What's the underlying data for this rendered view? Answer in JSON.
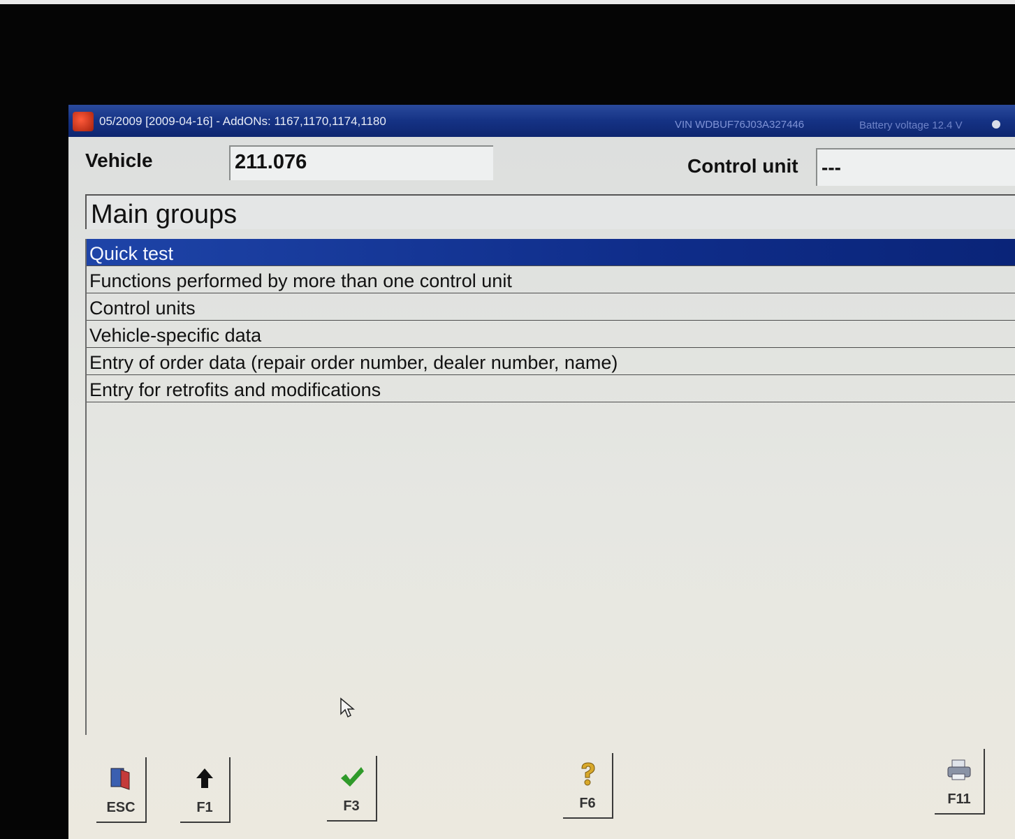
{
  "window": {
    "title": "05/2009 [2009-04-16] - AddONs: 1167,1170,1174,1180",
    "vin": "VIN  WDBUF76J03A327446",
    "battery": "Battery voltage  12.4 V"
  },
  "header": {
    "vehicle_label": "Vehicle",
    "vehicle_value": "211.076",
    "control_unit_label": "Control unit",
    "control_unit_value": "---"
  },
  "groups": {
    "title": "Main groups",
    "items": [
      {
        "label": "Quick test",
        "selected": true
      },
      {
        "label": "Functions performed by more than one control unit",
        "selected": false
      },
      {
        "label": "Control units",
        "selected": false
      },
      {
        "label": "Vehicle-specific data",
        "selected": false
      },
      {
        "label": "Entry of order data (repair order number, dealer number, name)",
        "selected": false
      },
      {
        "label": "Entry for retrofits and modifications",
        "selected": false
      }
    ]
  },
  "function_keys": [
    {
      "key": "ESC",
      "icon": "exit-door-icon"
    },
    {
      "key": "F1",
      "icon": "up-arrow-icon"
    },
    {
      "key": "F3",
      "icon": "checkmark-icon"
    },
    {
      "key": "F6",
      "icon": "help-question-icon"
    },
    {
      "key": "F11",
      "icon": "printer-icon"
    }
  ],
  "colors": {
    "titlebar": "#153284",
    "selection": "#1e44a8",
    "check": "#2f9a2a"
  }
}
